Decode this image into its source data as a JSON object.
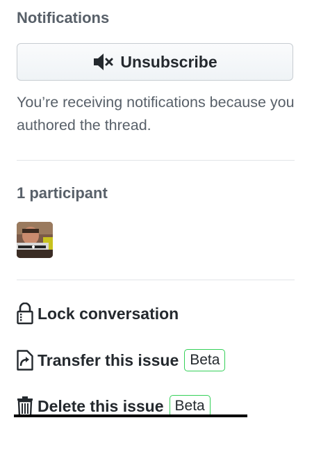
{
  "notifications": {
    "heading": "Notifications",
    "button_label": "Unsubscribe",
    "button_icon": "mute-icon",
    "reason": "You’re receiving notifications because you authored the thread."
  },
  "participants": {
    "heading": "1 participant"
  },
  "actions": {
    "lock": {
      "label": "Lock conversation",
      "icon": "lock-icon"
    },
    "transfer": {
      "label": "Transfer this issue",
      "badge": "Beta",
      "icon": "transfer-icon"
    },
    "delete": {
      "label": "Delete this issue",
      "badge": "Beta",
      "icon": "trash-icon"
    }
  },
  "colors": {
    "badge_border": "#34d058",
    "heading": "#586069",
    "text": "#24292e"
  }
}
